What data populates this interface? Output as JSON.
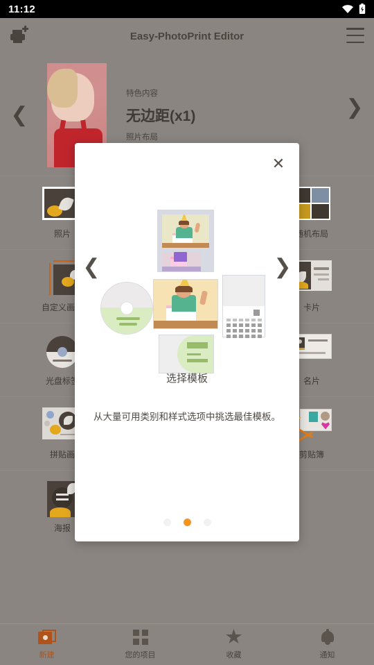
{
  "statusbar": {
    "time": "11:12",
    "wifi_icon": "wifi-icon",
    "battery_icon": "battery-icon"
  },
  "appbar": {
    "title": "Easy-PhotoPrint Editor",
    "printer_icon": "printer-add-icon",
    "menu_icon": "hamburger-menu-icon"
  },
  "hero": {
    "prev_icon": "chevron-left-icon",
    "next_icon": "chevron-right-icon",
    "kicker": "特色内容",
    "name": "无边距(x1)",
    "sub": "照片布局"
  },
  "grid": {
    "items": [
      {
        "label": "照片",
        "icon": "photo-stack-icon"
      },
      {
        "label": "",
        "icon": "hidden-behind-modal"
      },
      {
        "label": "随机布局",
        "icon": "random-layout-icon"
      },
      {
        "label": "自定义画面",
        "icon": "custom-size-icon"
      },
      {
        "label": "",
        "icon": "hidden-behind-modal"
      },
      {
        "label": "卡片",
        "icon": "card-icon"
      },
      {
        "label": "光盘标签",
        "icon": "disc-label-icon"
      },
      {
        "label": "",
        "icon": "hidden-behind-modal"
      },
      {
        "label": "名片",
        "icon": "business-card-icon"
      },
      {
        "label": "拼贴画",
        "icon": "collage-icon"
      },
      {
        "label": "",
        "icon": "hidden-behind-modal"
      },
      {
        "label": "剪贴簿",
        "icon": "scrapbook-icon"
      },
      {
        "label": "海报",
        "icon": "poster-icon"
      },
      {
        "label": "",
        "icon": "empty-cell"
      },
      {
        "label": "",
        "icon": "empty-cell"
      }
    ]
  },
  "bottomnav": {
    "items": [
      {
        "label": "新建",
        "icon": "new-project-icon",
        "active": true
      },
      {
        "label": "您的项目",
        "icon": "grid-projects-icon",
        "active": false
      },
      {
        "label": "收藏",
        "icon": "star-icon",
        "active": false
      },
      {
        "label": "通知",
        "icon": "bell-icon",
        "active": false
      }
    ]
  },
  "modal": {
    "close_icon": "close-icon",
    "prev_icon": "chevron-left-icon",
    "next_icon": "chevron-right-icon",
    "title": "选择模板",
    "description": "从大量可用类别和样式选项中挑选最佳模板。",
    "cards": [
      {
        "name": "photobook-template-card"
      },
      {
        "name": "disc-label-template-card"
      },
      {
        "name": "photo-template-card"
      },
      {
        "name": "calendar-template-card"
      },
      {
        "name": "card-template-card"
      }
    ],
    "pagination": {
      "total": 3,
      "current": 2
    }
  },
  "colors": {
    "accent": "#f7941d",
    "appbar_bg": "#8a8580",
    "modal_bg": "#ffffff",
    "text_dark": "#4a443e",
    "nav_active": "#b0531a"
  }
}
